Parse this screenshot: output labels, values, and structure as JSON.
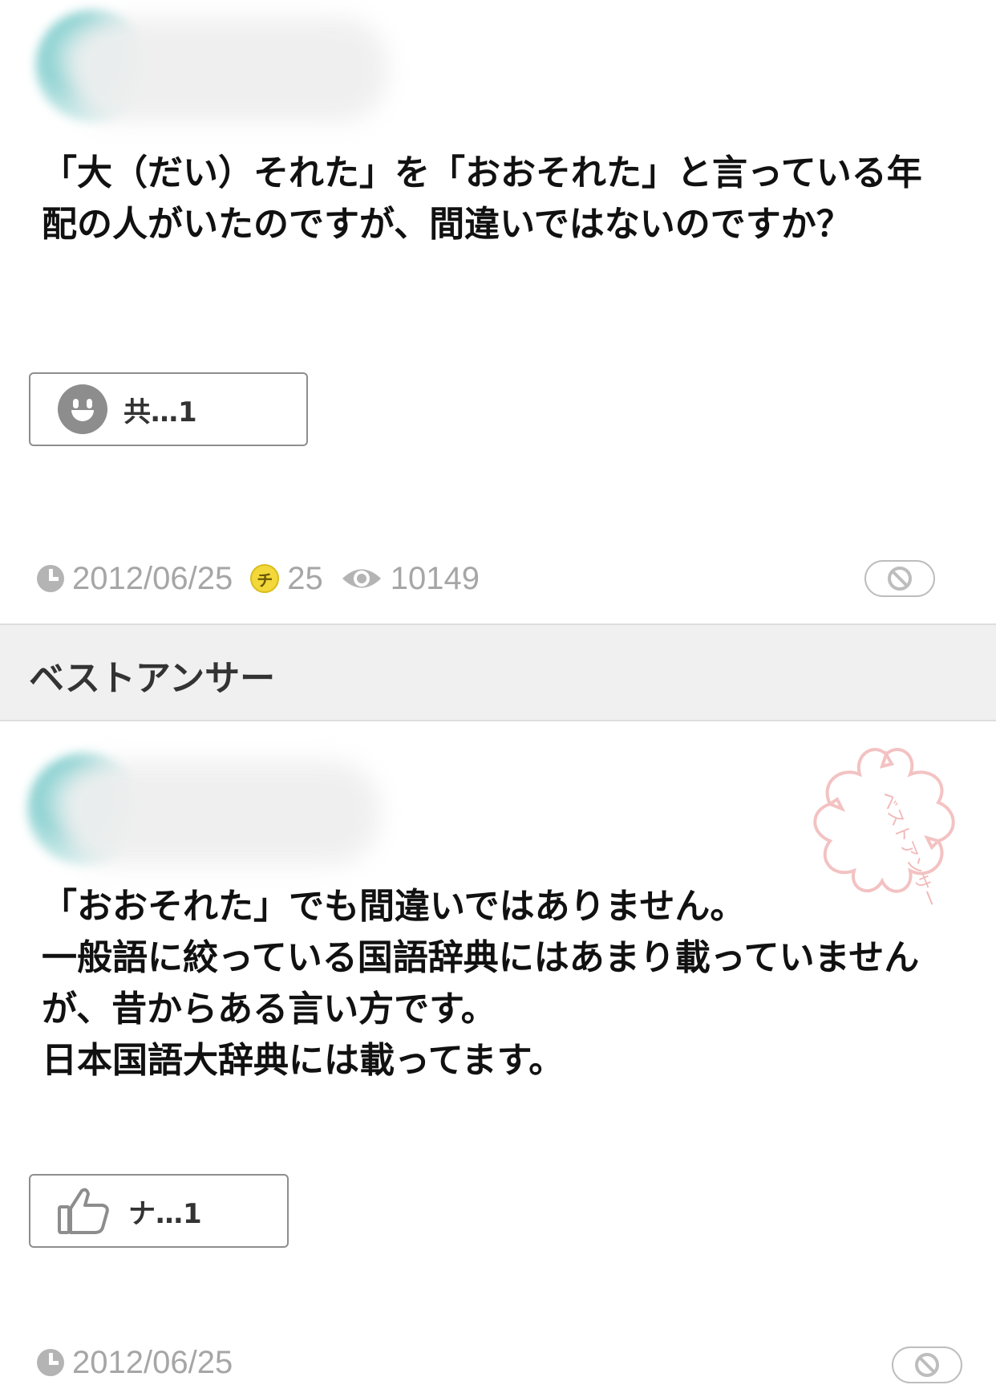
{
  "question": {
    "text": "「大（だい）それた」を「おおそれた」と言っている年配の人がいたのですが、間違いではないのですか？",
    "reaction_label": "共…1",
    "meta": {
      "date": "2012/06/25",
      "coin_glyph": "チ",
      "coins": "25",
      "views": "10149"
    }
  },
  "best_answer_section": {
    "title": "ベストアンサー"
  },
  "answer": {
    "text": "「おおそれた」でも間違いではありません。\n一般語に絞っている国語辞典にはあまり載っていませんが、昔からある言い方です。\n日本国語大辞典には載ってます。",
    "reaction_label": "ナ…1",
    "meta": {
      "date": "2012/06/25"
    },
    "stamp_text": "ベストアンサー",
    "stamp_color": "#f2b8b8"
  },
  "colors": {
    "accent_teal": "#8fd2d2",
    "meta_gray": "#a6a6a6",
    "band_bg": "#f0f0f0",
    "coin_yellow": "#f3d83b"
  },
  "icons": [
    "smiley-face-icon",
    "clock-icon",
    "coin-icon",
    "eye-icon",
    "block-icon",
    "thumbs-up-icon",
    "sakura-stamp-icon"
  ]
}
